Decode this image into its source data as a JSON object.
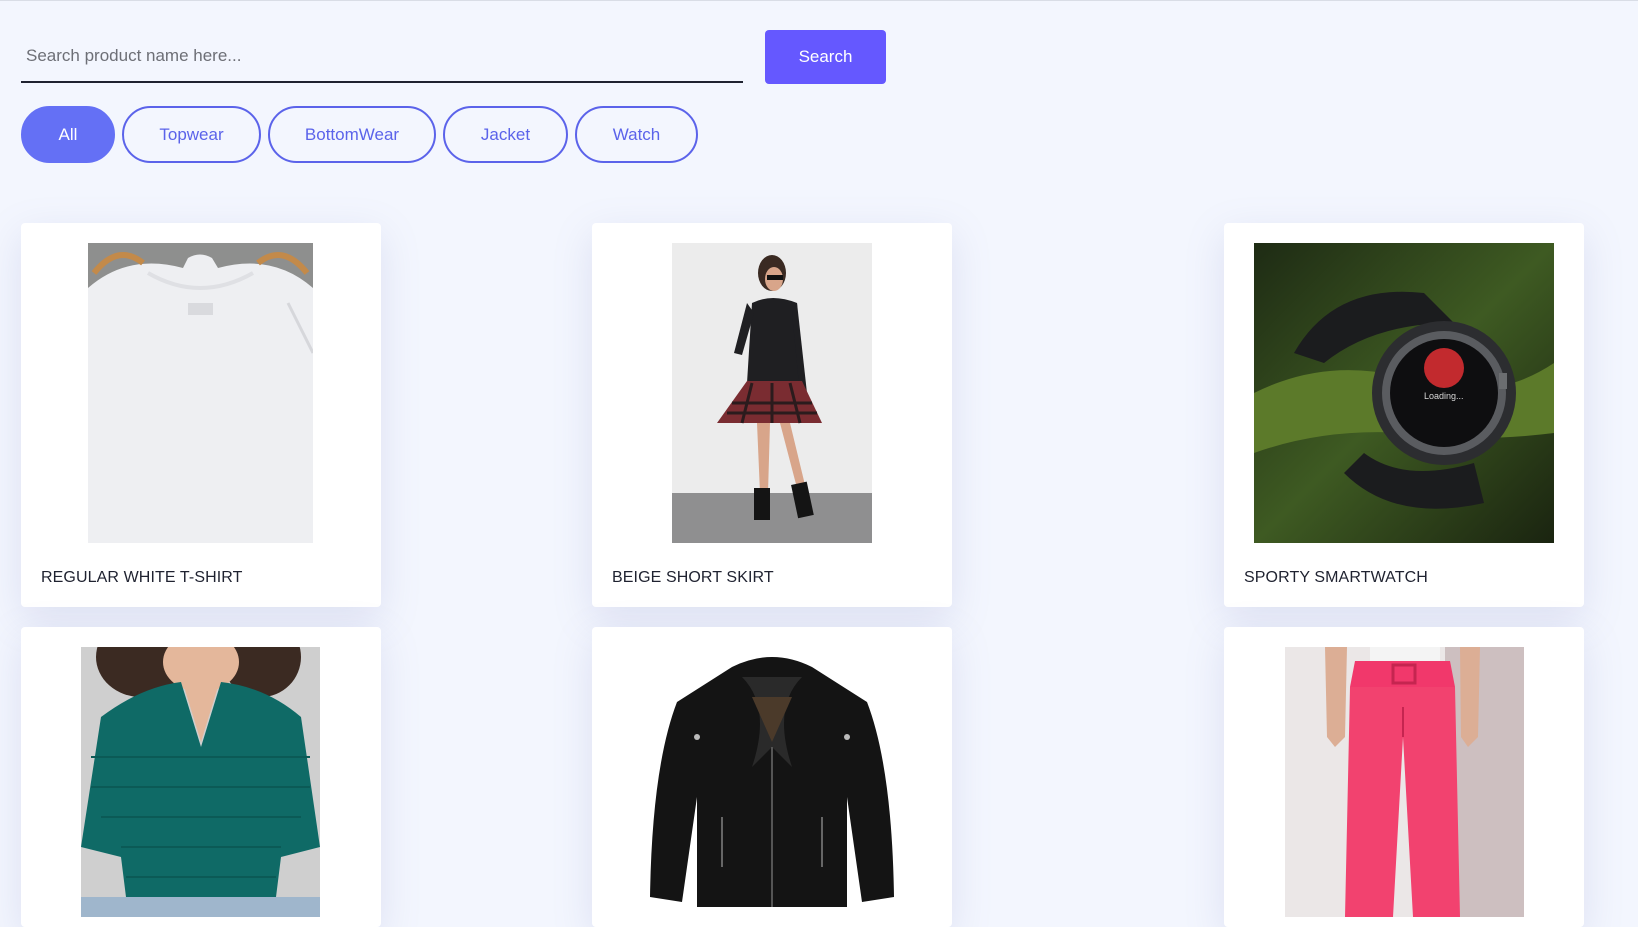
{
  "search": {
    "placeholder": "Search product name here...",
    "button_label": "Search"
  },
  "filters": [
    "All",
    "Topwear",
    "BottomWear",
    "Jacket",
    "Watch"
  ],
  "active_filter": "All",
  "products": [
    {
      "name": "REGULAR WHITE T-SHIRT",
      "image": "white-tshirt-photo"
    },
    {
      "name": "BEIGE SHORT SKIRT",
      "image": "plaid-skirt-photo"
    },
    {
      "name": "SPORTY SMARTWATCH",
      "image": "smartwatch-photo"
    },
    {
      "name": "",
      "image": "teal-sweater-photo"
    },
    {
      "name": "",
      "image": "black-leather-jacket-photo"
    },
    {
      "name": "",
      "image": "pink-trousers-photo"
    }
  ],
  "watch_screen_text": "Loading...",
  "colors": {
    "background": "#f3f6fe",
    "accent": "#6558ff",
    "chip_active": "#6470f5",
    "chip_border": "#5b63ea"
  }
}
